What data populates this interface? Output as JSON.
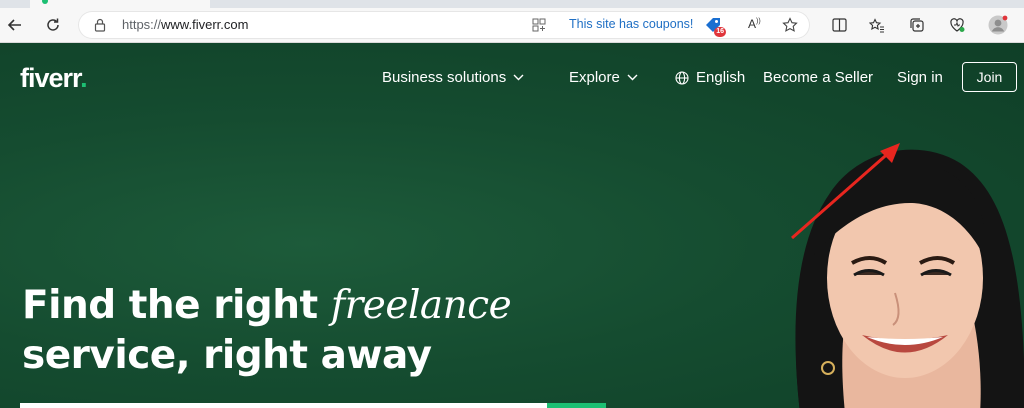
{
  "browser": {
    "address_bar": {
      "url_scheme": "https://",
      "url_host": "www.fiverr.com",
      "coupon_text": "This site has coupons!",
      "coupon_count": "16",
      "read_aloud": "A"
    }
  },
  "header": {
    "logo": "fiverr",
    "logo_dot": ".",
    "nav": {
      "business": "Business solutions",
      "explore": "Explore",
      "language": "English",
      "become_seller": "Become a Seller",
      "sign_in": "Sign in",
      "join": "Join"
    }
  },
  "hero": {
    "line1_plain": "Find the right ",
    "line1_italic": "freelance",
    "line2": "service, right away"
  },
  "colors": {
    "brand_green": "#1dbf73",
    "hero_bg": "#154c30",
    "annotation": "#e8261f"
  }
}
